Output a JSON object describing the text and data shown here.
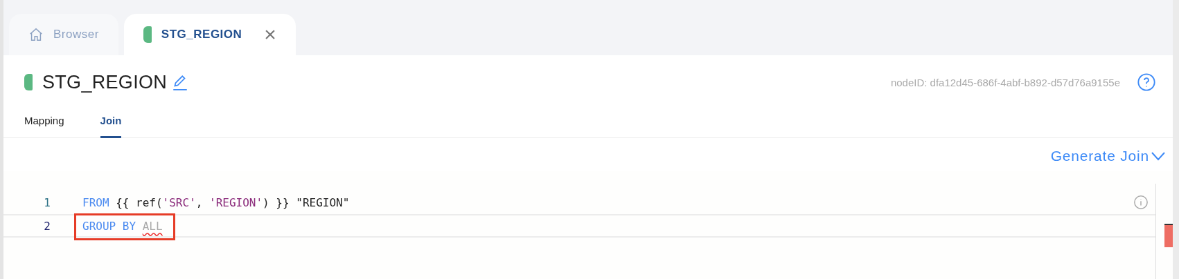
{
  "tabs": [
    {
      "kind": "home",
      "label": "Browser",
      "selected": false
    },
    {
      "kind": "node",
      "label": "STG_REGION",
      "selected": true,
      "close": "×"
    }
  ],
  "header": {
    "title": "STG_REGION",
    "node_id": "nodeID: dfa12d45-686f-4abf-b892-d57d76a9155e"
  },
  "subtabs": [
    {
      "label": "Mapping",
      "selected": false
    },
    {
      "label": "Join",
      "selected": true
    }
  ],
  "generate_button": {
    "label": "Generate Join"
  },
  "editor": {
    "lines": [
      {
        "number": "1",
        "current": false,
        "tokens": [
          {
            "text": "FROM",
            "kind": "keyword"
          },
          {
            "text": " {{ ref(",
            "kind": "plain"
          },
          {
            "text": "'SRC'",
            "kind": "string"
          },
          {
            "text": ", ",
            "kind": "plain"
          },
          {
            "text": "'REGION'",
            "kind": "string"
          },
          {
            "text": ") }} \"REGION\"",
            "kind": "plain"
          }
        ]
      },
      {
        "number": "2",
        "current": true,
        "annotated": true,
        "tokens": [
          {
            "text": "GROUP BY ",
            "kind": "keyword"
          },
          {
            "text": "ALL",
            "kind": "error"
          }
        ]
      }
    ]
  }
}
